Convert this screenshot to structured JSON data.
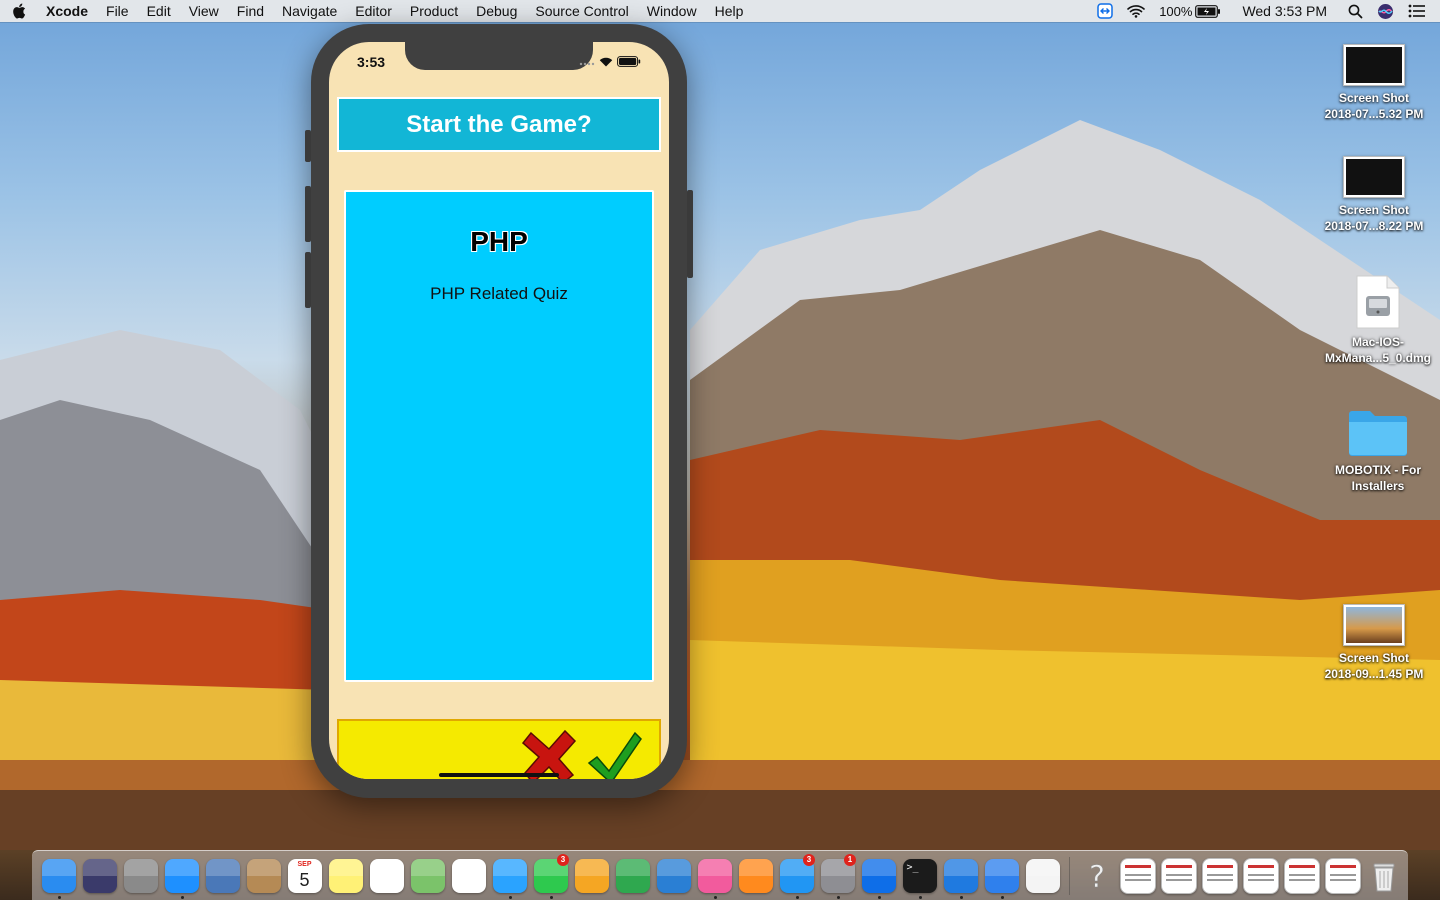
{
  "menubar": {
    "app_name": "Xcode",
    "items": [
      "File",
      "Edit",
      "View",
      "Find",
      "Navigate",
      "Editor",
      "Product",
      "Debug",
      "Source Control",
      "Window",
      "Help"
    ],
    "battery_percent": "100%",
    "clock": "Wed 3:53 PM"
  },
  "desktop_icons": [
    {
      "name": "Screen Shot",
      "detail": "2018-07...5.32 PM",
      "kind": "screenshot"
    },
    {
      "name": "Screen Shot",
      "detail": "2018-07...8.22 PM",
      "kind": "screenshot"
    },
    {
      "name": "Mac-IOS-",
      "detail": "MxMana...5_0.dmg",
      "kind": "disk-image"
    },
    {
      "name": "MOBOTIX - For",
      "detail": "Installers",
      "kind": "folder"
    },
    {
      "name": "Screen Shot",
      "detail": "2018-09...1.45 PM",
      "kind": "screenshot"
    }
  ],
  "simulator": {
    "status_time": "3:53",
    "title": "Start the Game?",
    "card": {
      "title": "PHP",
      "subtitle": "PHP Related Quiz"
    },
    "colors": {
      "screen": "#f8e3b4",
      "title_bar": "#12b6d6",
      "card": "#00cdff",
      "bottom_bar": "#f5ea00",
      "no": "#c8140f",
      "yes": "#1f9e1f"
    }
  },
  "dock": {
    "apps": [
      {
        "name": "finder-icon",
        "color": "#2a8cf0"
      },
      {
        "name": "siri-icon",
        "color": "#3a3a6a"
      },
      {
        "name": "launchpad-icon",
        "color": "#8a8a8a"
      },
      {
        "name": "safari-icon",
        "color": "#1e90ff"
      },
      {
        "name": "mail-stamp-icon",
        "color": "#4a78b8"
      },
      {
        "name": "contacts-icon",
        "color": "#b58a55"
      },
      {
        "name": "calendar-icon",
        "color": "#ffffff",
        "text": "5",
        "month": "SEP"
      },
      {
        "name": "notes-icon",
        "color": "#fff176"
      },
      {
        "name": "reminders-icon",
        "color": "#ffffff"
      },
      {
        "name": "maps-icon",
        "color": "#7bc36a"
      },
      {
        "name": "photos-icon",
        "color": "#ffffff"
      },
      {
        "name": "messages-icon",
        "color": "#2aa3ff"
      },
      {
        "name": "facetime-icon",
        "color": "#2ec94e",
        "badge": "3"
      },
      {
        "name": "pages-icon",
        "color": "#f5a623"
      },
      {
        "name": "numbers-icon",
        "color": "#2fa84f"
      },
      {
        "name": "keynote-icon",
        "color": "#2a7fd4"
      },
      {
        "name": "itunes-icon",
        "color": "#f25b9d"
      },
      {
        "name": "ibooks-icon",
        "color": "#ff8a1e"
      },
      {
        "name": "app-store-icon",
        "color": "#2196f3",
        "badge": "3"
      },
      {
        "name": "system-preferences-icon",
        "color": "#8e8e93",
        "badge": "1"
      },
      {
        "name": "teamviewer-icon",
        "color": "#0e6ee8"
      },
      {
        "name": "terminal-icon",
        "color": "#1b1b1b"
      },
      {
        "name": "xcode-icon",
        "color": "#1f7ae0"
      },
      {
        "name": "simulator-icon",
        "color": "#2f80ed"
      },
      {
        "name": "textedit-icon",
        "color": "#f4f4f4"
      }
    ],
    "others": [
      {
        "name": "help-icon",
        "color": "#f2f2f2"
      },
      {
        "name": "document-icon",
        "color": "#ffffff"
      },
      {
        "name": "document-icon",
        "color": "#ffffff"
      },
      {
        "name": "document-icon",
        "color": "#ffffff"
      },
      {
        "name": "document-icon",
        "color": "#ffffff"
      },
      {
        "name": "document-icon",
        "color": "#ffffff"
      },
      {
        "name": "document-icon",
        "color": "#ffffff"
      },
      {
        "name": "trash-icon",
        "color": "#e8e8e8"
      }
    ]
  }
}
